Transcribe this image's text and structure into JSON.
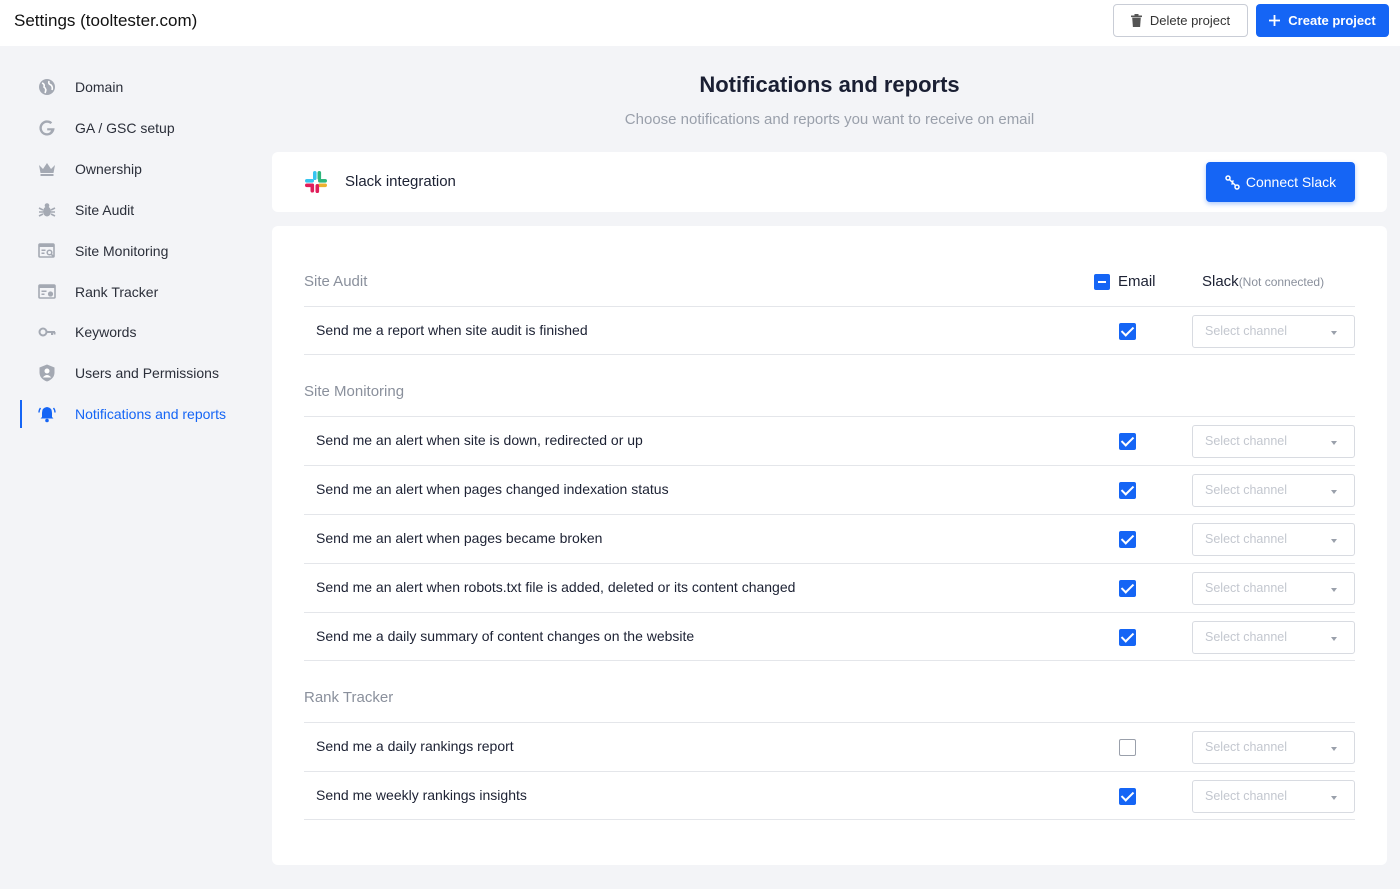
{
  "header": {
    "title": "Settings (tooltester.com)",
    "delete_label": "Delete project",
    "create_label": "Create project"
  },
  "sidebar": {
    "items": [
      {
        "label": "Domain",
        "icon": "globe-icon"
      },
      {
        "label": "GA / GSC setup",
        "icon": "google-icon"
      },
      {
        "label": "Ownership",
        "icon": "crown-icon"
      },
      {
        "label": "Site Audit",
        "icon": "bug-icon"
      },
      {
        "label": "Site Monitoring",
        "icon": "monitor-search-icon"
      },
      {
        "label": "Rank Tracker",
        "icon": "rank-tracker-icon"
      },
      {
        "label": "Keywords",
        "icon": "key-icon"
      },
      {
        "label": "Users and Permissions",
        "icon": "shield-user-icon"
      },
      {
        "label": "Notifications and reports",
        "icon": "bell-icon",
        "active": true
      }
    ]
  },
  "main": {
    "title": "Notifications and reports",
    "subtitle": "Choose notifications and reports you want to receive on email"
  },
  "slack": {
    "label": "Slack integration",
    "connect_label": "Connect Slack"
  },
  "columns": {
    "email": "Email",
    "slack": "Slack",
    "slack_status": "(Not connected)"
  },
  "select_placeholder": "Select channel",
  "sections": [
    {
      "title": "Site Audit",
      "rows": [
        {
          "label": "Send me a report when site audit is finished",
          "email": true
        }
      ]
    },
    {
      "title": "Site Monitoring",
      "rows": [
        {
          "label": "Send me an alert when site is down, redirected or up",
          "email": true
        },
        {
          "label": "Send me an alert when pages changed indexation status",
          "email": true
        },
        {
          "label": "Send me an alert when pages became broken",
          "email": true
        },
        {
          "label": "Send me an alert when robots.txt file is added, deleted or its content changed",
          "email": true
        },
        {
          "label": "Send me a daily summary of content changes on the website",
          "email": true
        }
      ]
    },
    {
      "title": "Rank Tracker",
      "rows": [
        {
          "label": "Send me a daily rankings report",
          "email": false
        },
        {
          "label": "Send me weekly rankings insights",
          "email": true
        }
      ]
    }
  ],
  "colors": {
    "accent": "#1565f5",
    "muted": "#8a909c"
  }
}
